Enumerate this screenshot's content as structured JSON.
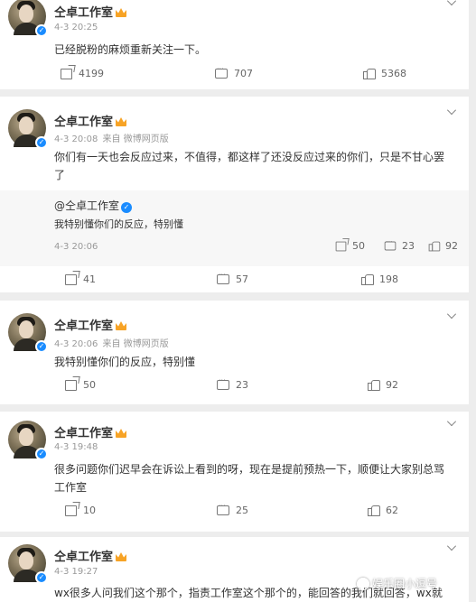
{
  "posts": [
    {
      "author": "仝卓工作室",
      "time": "4-3 20:25",
      "source": "",
      "text": "已经脱粉的麻烦重新关注一下。",
      "shares": "4199",
      "comments": "707",
      "likes": "5368"
    },
    {
      "author": "仝卓工作室",
      "time": "4-3 20:08",
      "source": "来自 微博网页版",
      "text": "你们有一天也会反应过来，不值得，都这样了还没反应过来的你们，只是不甘心罢了",
      "quote": {
        "author": "@仝卓工作室",
        "text": "我特别懂你们的反应，特别懂",
        "time": "4-3 20:06",
        "shares": "50",
        "comments": "23",
        "likes": "92"
      },
      "shares": "41",
      "comments": "57",
      "likes": "198"
    },
    {
      "author": "仝卓工作室",
      "time": "4-3 20:06",
      "source": "来自 微博网页版",
      "text": "我特别懂你们的反应，特别懂",
      "shares": "50",
      "comments": "23",
      "likes": "92"
    },
    {
      "author": "仝卓工作室",
      "time": "4-3 19:48",
      "source": "",
      "text": "很多问题你们迟早会在诉讼上看到的呀，现在是提前预热一下，顺便让大家别总骂工作室",
      "shares": "10",
      "comments": "25",
      "likes": "62"
    },
    {
      "author": "仝卓工作室",
      "time": "4-3 19:27",
      "source": "",
      "text": "wx很多人问我们这个那个，指责工作室这个那个的，能回答的我们就回答，wx就"
    }
  ],
  "watermark": "娱乐圈小逗号",
  "colors": {
    "background": "#ededed",
    "card": "#ffffff",
    "quote_bg": "#f7f7f7",
    "verified": "#1a8cff",
    "crown": "#f7a325"
  },
  "icons": [
    "chevron-down-icon",
    "verified-icon",
    "vip-crown-icon",
    "share-icon",
    "comment-icon",
    "like-icon"
  ]
}
